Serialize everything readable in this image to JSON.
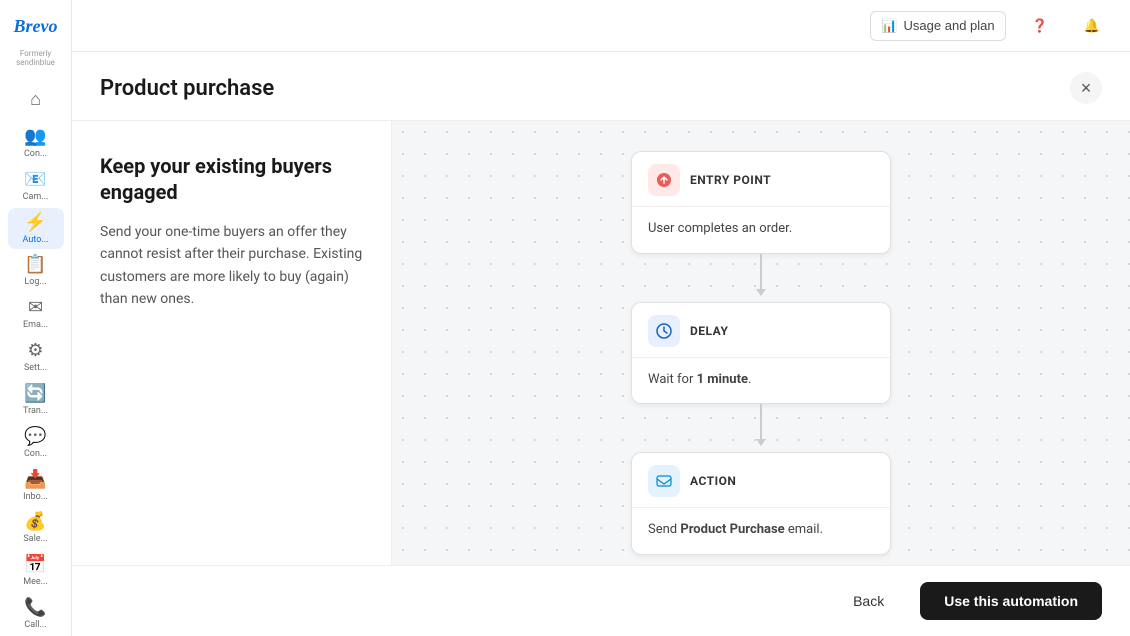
{
  "app": {
    "logo": "Brevo",
    "formerly": "Formerly sendinblue"
  },
  "header": {
    "usage_plan_label": "Usage and plan",
    "help_icon": "❓",
    "bell_icon": "🔔"
  },
  "sidebar": {
    "items": [
      {
        "id": "home",
        "icon": "⌂",
        "label": "Home"
      },
      {
        "id": "contacts",
        "icon": "👥",
        "label": "Con..."
      },
      {
        "id": "campaigns",
        "icon": "📧",
        "label": "Cam..."
      },
      {
        "id": "automations",
        "icon": "⚡",
        "label": "Auto..."
      },
      {
        "id": "logs",
        "icon": "📋",
        "label": "Log..."
      },
      {
        "id": "email",
        "icon": "✉",
        "label": "Ema..."
      },
      {
        "id": "settings",
        "icon": "⚙",
        "label": "Sett..."
      },
      {
        "id": "transactional",
        "icon": "🔄",
        "label": "Tran..."
      },
      {
        "id": "conversations",
        "icon": "💬",
        "label": "Con..."
      },
      {
        "id": "inbox",
        "icon": "📥",
        "label": "Inbo..."
      },
      {
        "id": "sales",
        "icon": "💰",
        "label": "Sale..."
      },
      {
        "id": "meetings",
        "icon": "📅",
        "label": "Mee..."
      },
      {
        "id": "calls",
        "icon": "📞",
        "label": "Call..."
      }
    ]
  },
  "modal": {
    "title": "Product purchase",
    "close_label": "×",
    "left_panel": {
      "heading": "Keep your existing buyers engaged",
      "description": "Send your one-time buyers an offer they cannot resist after their purchase. Existing customers are more likely to buy (again) than new ones."
    },
    "flow": {
      "nodes": [
        {
          "id": "entry",
          "type": "entry",
          "title": "ENTRY POINT",
          "icon": "🔴",
          "description": "User completes an order."
        },
        {
          "id": "delay",
          "type": "delay",
          "title": "DELAY",
          "icon": "⏱",
          "description_prefix": "Wait for ",
          "description_bold": "1 minute",
          "description_suffix": "."
        },
        {
          "id": "action",
          "type": "action",
          "title": "ACTION",
          "icon": "➤",
          "description_prefix": "Send ",
          "description_bold": "Product Purchase",
          "description_suffix": " email."
        }
      ]
    },
    "footer": {
      "back_label": "Back",
      "use_label": "Use this automation"
    }
  }
}
